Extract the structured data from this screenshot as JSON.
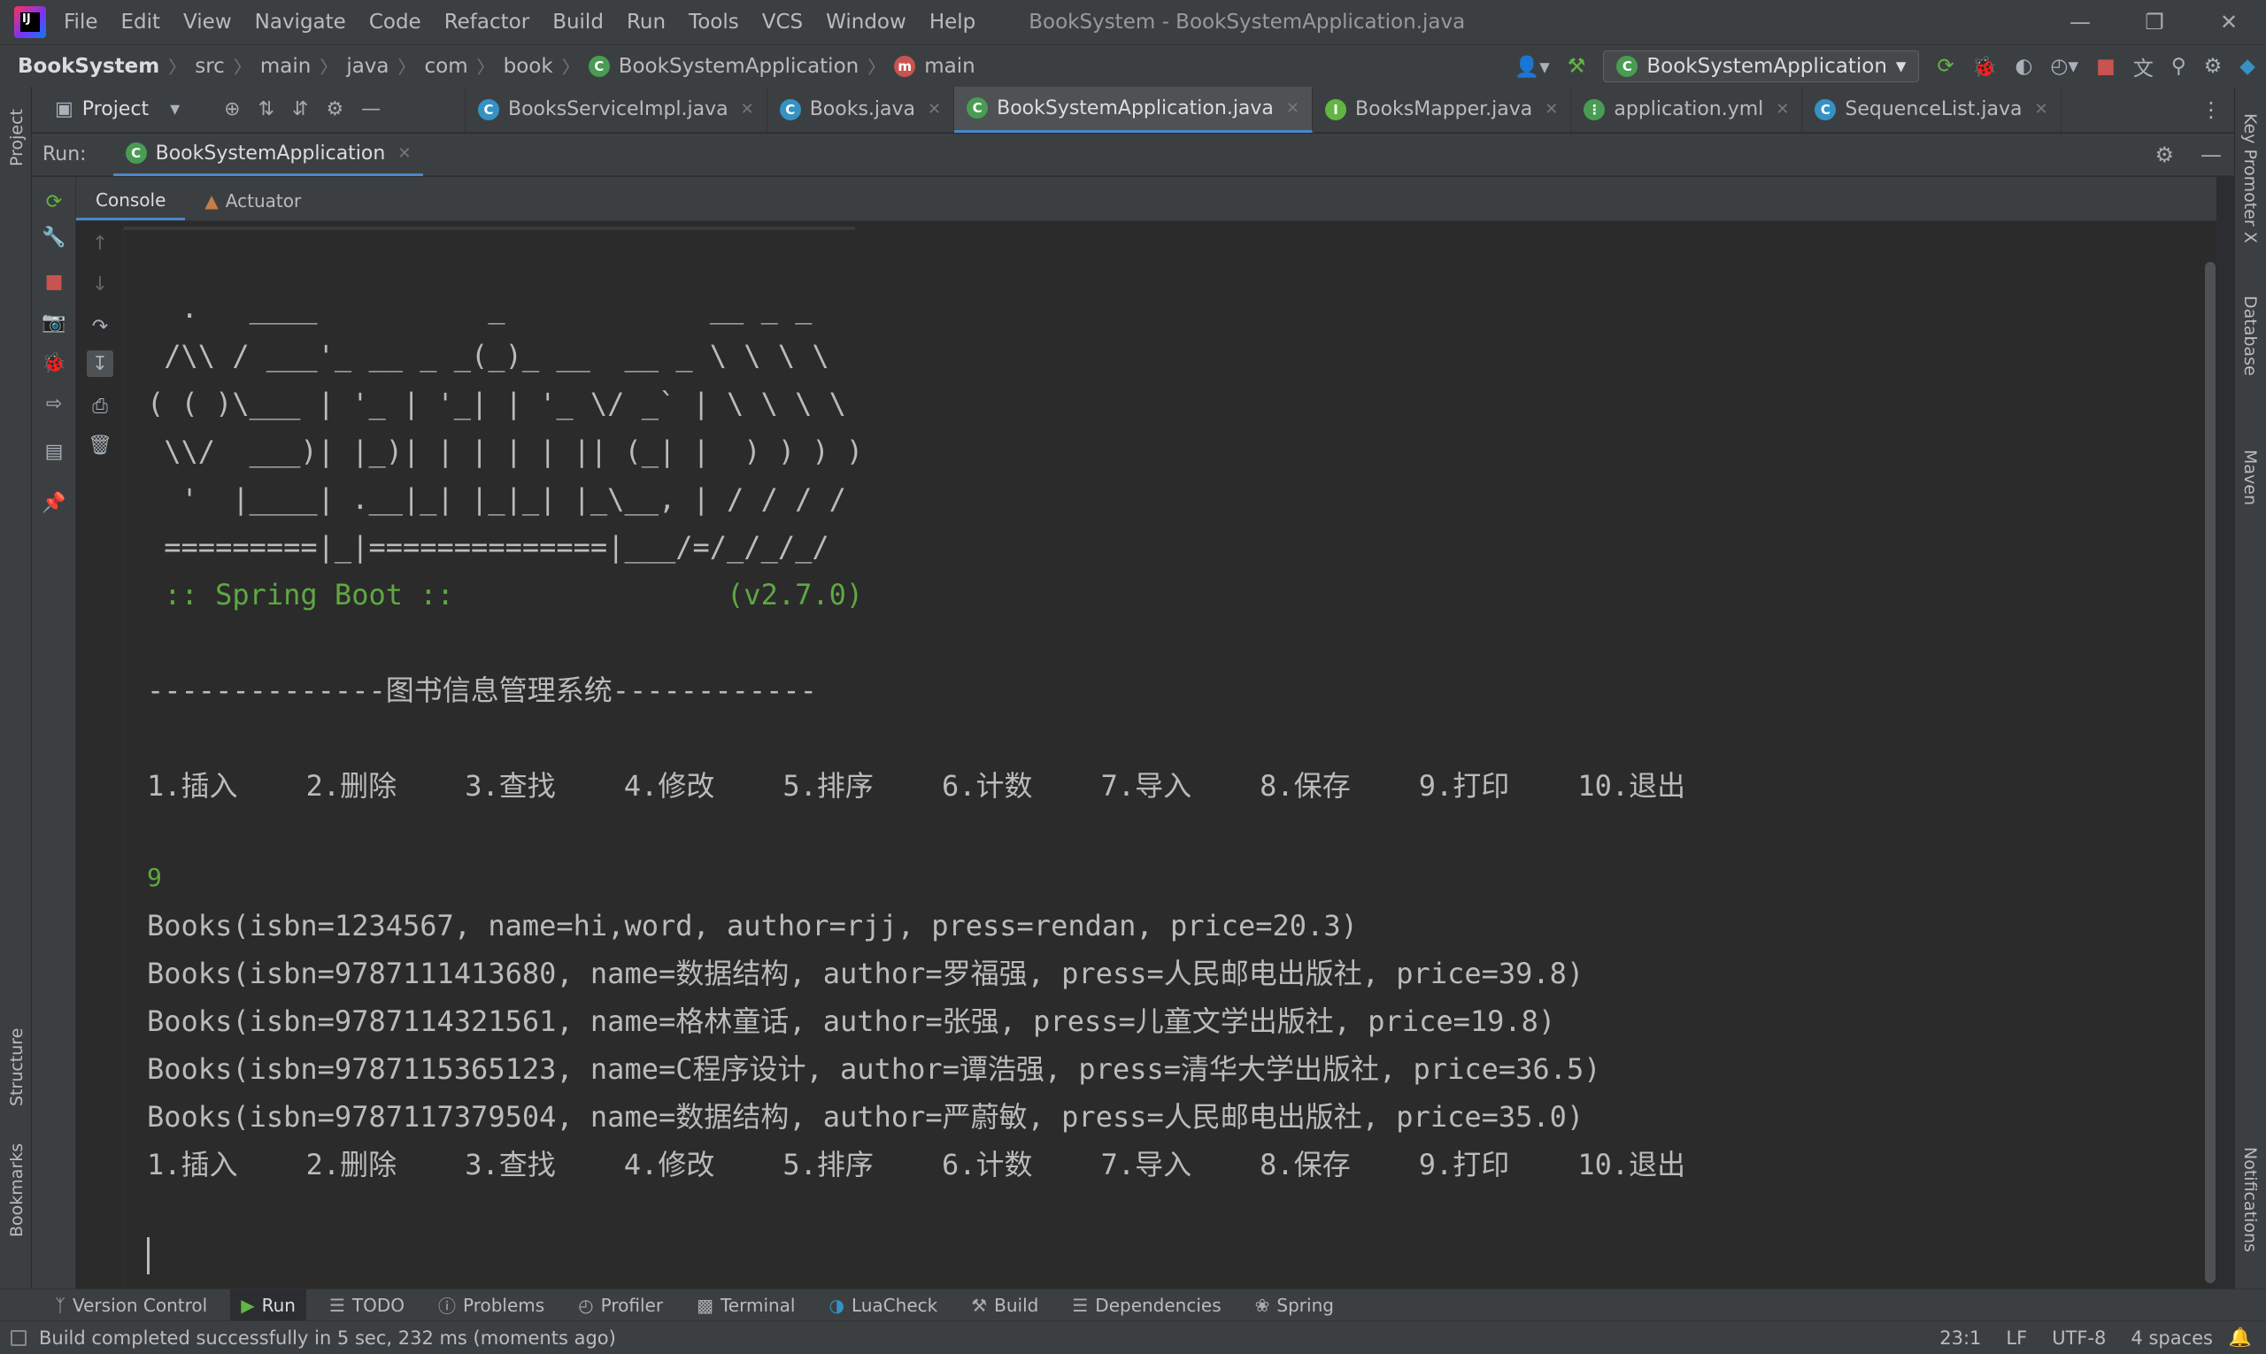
{
  "menu": [
    "File",
    "Edit",
    "View",
    "Navigate",
    "Code",
    "Refactor",
    "Build",
    "Run",
    "Tools",
    "VCS",
    "Window",
    "Help"
  ],
  "window_title": "BookSystem - BookSystemApplication.java",
  "breadcrumb": [
    "BookSystem",
    "src",
    "main",
    "java",
    "com",
    "book",
    "BookSystemApplication",
    "main"
  ],
  "run_config": "BookSystemApplication",
  "project_label": "Project",
  "editor_tabs": [
    {
      "label": "BooksServiceImpl.java",
      "icon": "class-icon"
    },
    {
      "label": "Books.java",
      "icon": "class-icon"
    },
    {
      "label": "BookSystemApplication.java",
      "icon": "spring-class-icon",
      "active": true
    },
    {
      "label": "BooksMapper.java",
      "icon": "interface-icon"
    },
    {
      "label": "application.yml",
      "icon": "yaml-icon"
    },
    {
      "label": "SequenceList.java",
      "icon": "class-icon"
    }
  ],
  "run_panel": {
    "label": "Run:",
    "tab": "BookSystemApplication"
  },
  "sub_tabs": [
    "Console",
    "Actuator"
  ],
  "left_stripe": {
    "project": "Project",
    "structure": "Structure",
    "bookmarks": "Bookmarks"
  },
  "right_stripe": {
    "key_promoter": "Key Promoter X",
    "database": "Database",
    "maven": "Maven",
    "notifications": "Notifications"
  },
  "console_lines": [
    "  .   ____          _            __ _ _",
    " /\\\\ / ___'_ __ _ _(_)_ __  __ _ \\ \\ \\ \\",
    "( ( )\\___ | '_ | '_| | '_ \\/ _` | \\ \\ \\ \\",
    " \\\\/  ___)| |_)| | | | | || (_| |  ) ) ) )",
    "  '  |____| .__|_| |_|_| |_\\__, | / / / /",
    " =========|_|==============|___/=/_/_/_/",
    " :: Spring Boot ::                (v2.7.0)",
    "--------------图书信息管理系统------------",
    "1.插入    2.删除    3.查找    4.修改    5.排序    6.计数    7.导入    8.保存    9.打印    10.退出",
    "9",
    "Books(isbn=1234567, name=hi,word, author=rjj, press=rendan, price=20.3)",
    "Books(isbn=9787111413680, name=数据结构, author=罗福强, press=人民邮电出版社, price=39.8)",
    "Books(isbn=9787114321561, name=格林童话, author=张强, press=儿童文学出版社, price=19.8)",
    "Books(isbn=9787115365123, name=C程序设计, author=谭浩强, press=清华大学出版社, price=36.5)",
    "Books(isbn=9787117379504, name=数据结构, author=严蔚敏, press=人民邮电出版社, price=35.0)",
    "1.插入    2.删除    3.查找    4.修改    5.排序    6.计数    7.导入    8.保存    9.打印    10.退出"
  ],
  "tool_windows": [
    "Version Control",
    "Run",
    "TODO",
    "Problems",
    "Profiler",
    "Terminal",
    "LuaCheck",
    "Build",
    "Dependencies",
    "Spring"
  ],
  "status": {
    "message": "Build completed successfully in 5 sec, 232 ms (moments ago)",
    "position": "23:1",
    "line_sep": "LF",
    "encoding": "UTF-8",
    "indent": "4 spaces"
  },
  "colors": {
    "accent": "#4a88c7",
    "console_green": "#5fa843",
    "stop_red": "#c75450"
  }
}
